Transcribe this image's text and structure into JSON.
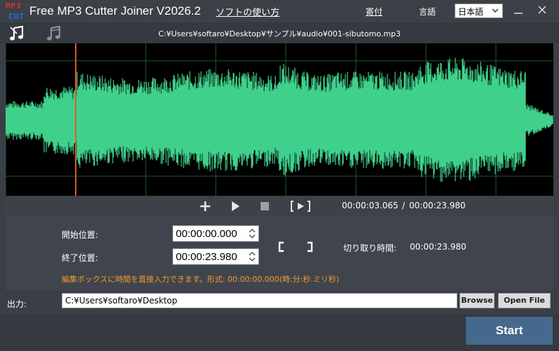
{
  "app": {
    "title": "Free MP3 Cutter Joiner V2026.2",
    "howto_link": "ソフトの使い方",
    "donate_link": "寄付",
    "language_label": "言語",
    "language_value": "日本語",
    "logo": {
      "line1": "MP3",
      "line2": "CUT"
    }
  },
  "toolbar": {
    "icons": [
      "cut-music-icon",
      "join-music-icon"
    ],
    "file_path": "C:¥Users¥softaro¥Desktop¥サンプル¥audio¥001-sibutomo.mp3"
  },
  "waveform": {
    "color": "#3fd18c",
    "background": "#000000",
    "grid_color": "#1f5a2a",
    "cursor_color": "#e05a28",
    "cursor_fraction": 0.128
  },
  "playback": {
    "icons": [
      "plus-icon",
      "play-icon",
      "stop-icon",
      "play-selection-icon"
    ],
    "current_time": "00:00:03.065",
    "separator": "/",
    "total_time": "00:00:23.980"
  },
  "trim": {
    "start_label": "開始位置:",
    "start_value": "00:00:00.000",
    "end_label": "終了位置:",
    "end_value": "00:00:23.980",
    "set_start_icon": "bracket-left-icon",
    "set_end_icon": "bracket-right-icon",
    "cut_duration_label": "切り取り時間:",
    "cut_duration_value": "00:00:23.980",
    "hint": "編集ボックスに時間を直接入力できます。形式: 00:00:00.000(時:分:秒.ミリ秒)",
    "hint_color": "#f29a2e"
  },
  "output": {
    "label": "出力:",
    "path": "C:¥Users¥softaro¥Desktop",
    "browse_label": "Browse",
    "open_file_label": "Open File"
  },
  "start_button": {
    "label": "Start",
    "color": "#45698c"
  }
}
